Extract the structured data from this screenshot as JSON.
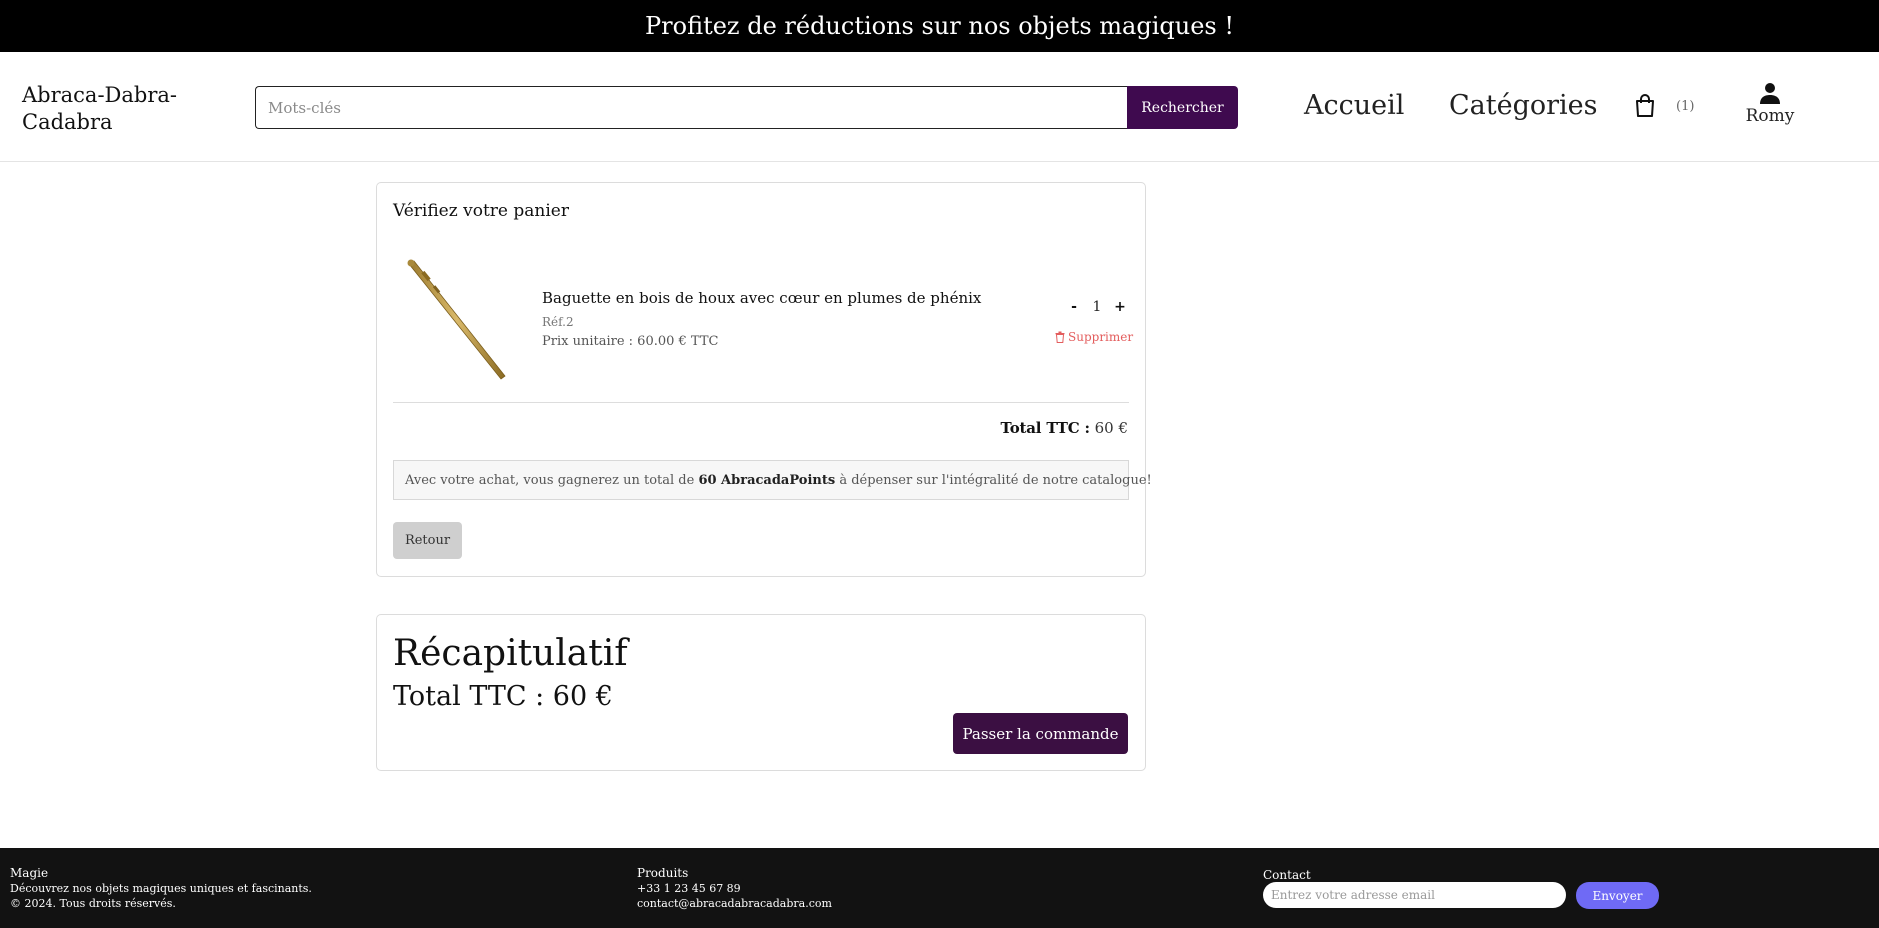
{
  "banner": {
    "text": "Profitez de réductions sur nos objets magiques !"
  },
  "header": {
    "logo": "Abraca-Dabra-Cadabra",
    "search": {
      "placeholder": "Mots-clés",
      "button_label": "Rechercher"
    },
    "nav": {
      "home": "Accueil",
      "categories": "Catégories"
    },
    "cart": {
      "icon": "shopping-bag-icon",
      "count": "(1)"
    },
    "user": {
      "icon": "user-icon",
      "name": "Romy"
    }
  },
  "cart": {
    "title": "Vérifiez votre panier",
    "item": {
      "name": "Baguette en bois de houx avec cœur en plumes de phénix",
      "ref": "Réf.2",
      "unit_price": "Prix unitaire : 60.00 € TTC",
      "quantity": "1",
      "decrement_label": "-",
      "increment_label": "+",
      "remove_label": "Supprimer"
    },
    "total_label": "Total TTC :",
    "total_value": "60 €",
    "points": {
      "prefix": "Avec votre achat, vous gagnerez un total de",
      "highlight": "60 AbracadaPoints",
      "suffix": "à dépenser sur l'intégralité de notre catalogue!"
    },
    "back_label": "Retour"
  },
  "summary": {
    "title": "Récapitulatif",
    "total": "Total TTC : 60 €",
    "order_label": "Passer la commande"
  },
  "footer": {
    "col1": {
      "title": "Magie",
      "line1": "Découvrez nos objets magiques uniques et fascinants.",
      "line2": "© 2024. Tous droits réservés."
    },
    "col2": {
      "title": "Produits",
      "phone": "+33 1 23 45 67 89",
      "email": "contact@abracadabracadabra.com"
    },
    "col3": {
      "title": "Contact",
      "placeholder": "Entrez votre adresse email",
      "button_label": "Envoyer"
    }
  },
  "colors": {
    "primary": "#3f0a4f",
    "remove": "#e35d5d",
    "newsletter_button": "#6f6af5"
  }
}
